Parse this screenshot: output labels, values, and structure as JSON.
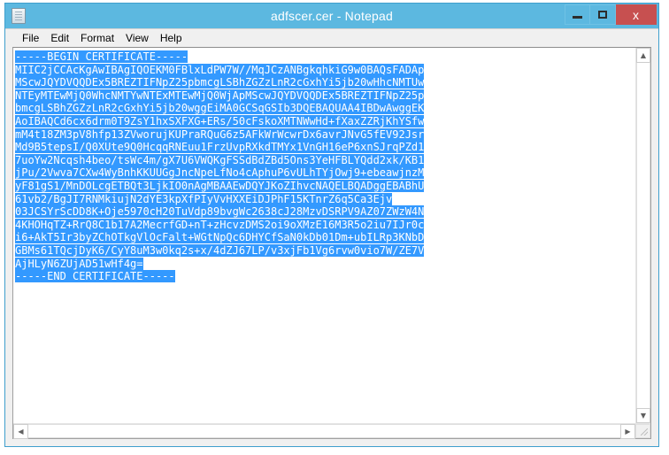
{
  "window": {
    "title": "adfscer.cer - Notepad",
    "app_icon": "notepad-document-icon",
    "caption": {
      "minimize_label": "",
      "maximize_label": "",
      "close_label": "x"
    },
    "colors": {
      "titlebar": "#5cb8e0",
      "close_button": "#c75050",
      "menu_bar": "#f0f0f0",
      "selection": "#3399ff",
      "selection_text": "#ffffff"
    }
  },
  "menu": {
    "items": [
      {
        "label": "File"
      },
      {
        "label": "Edit"
      },
      {
        "label": "Format"
      },
      {
        "label": "View"
      },
      {
        "label": "Help"
      }
    ]
  },
  "scrollbars": {
    "vertical": {
      "up_arrow": "chevron-up-icon",
      "down_arrow": "chevron-down-icon"
    },
    "horizontal": {
      "left_arrow": "chevron-left-icon",
      "right_arrow": "chevron-right-icon"
    }
  },
  "document": {
    "all_selected": true,
    "lines": [
      "-----BEGIN CERTIFICATE-----",
      "MIIC2jCCAcKgAwIBAgIQOEKM0FBlxLdPW7W//MqJCzANBgkqhkiG9w0BAQsFADAp",
      "MScwJQYDVQQDEx5BREZTIFNpZ25pbmcgLSBhZGZzLnR2cGxhYi5jb20wHhcNMTUw",
      "NTEyMTEwMjQ0WhcNMTYwNTExMTEwMjQ0WjApMScwJQYDVQQDEx5BREZTIFNpZ25p",
      "bmcgLSBhZGZzLnR2cGxhYi5jb20wggEiMA0GCSqGSIb3DQEBAQUAA4IBDwAwggEK",
      "AoIBAQCd6cx6drm0T9ZsY1hxSXFXG+ERs/50cFskoXMTNWwHd+fXaxZZRjKhYSfw",
      "mM4t18ZM3pV8hfp13ZVworujKUPraRQuG6z5AFkWrWcwrDx6avrJNvG5fEV92Jsr",
      "Md9B5tepsI/Q0XUte9Q0HcqqRNEuu1FrzUvpRXkdTMYx1VnGH16eP6xnSJrqPZd1",
      "7uoYw2Ncqsh4beo/tsWc4m/gX7U6VWQKgFSSdBdZBd5Ons3YeHFBLYQdd2xk/KB1",
      "jPu/2Vwva7CXw4WyBnhKKUUGgJncNpeLfNo4cAphuP6vULhTYjOwj9+ebeawjnzM",
      "yF81gS1/MnDOLcgETBQt3LjkIO0nAgMBAAEwDQYJKoZIhvcNAQELBQADggEBABhU",
      "61vb2/BgJI7RNMkiujN2dYE3kpXfPIyVvHXXEiDJPhF15KTnrZ6q5Ca3Ejv",
      "03JCSYrScDD8K+Oje5970cH20TuVdp89bvgWc2638cJ28MzvDSRPV9AZ07ZWzW4N",
      "4KHOHqTZ+RrQ8C1b17A2MecrfGD+nT+zHcvzDMS2oi9oXMzE16M3R5o2iu7IJr0c",
      "i6+AkT5Ir3byZChOTkgVlOcFalt+WGtNpQc6DHYCfSaN0kDb01Dm+ubILRp3KNbD",
      "GBMs61TQcjDyK6/CyY8uM3w0kq2s+x/4dZJ67LP/v3xjFb1Vg6rvw0vio7W/ZE7V",
      "AjHLyN6ZUjAD51wHf4g=",
      "-----END CERTIFICATE-----"
    ]
  }
}
